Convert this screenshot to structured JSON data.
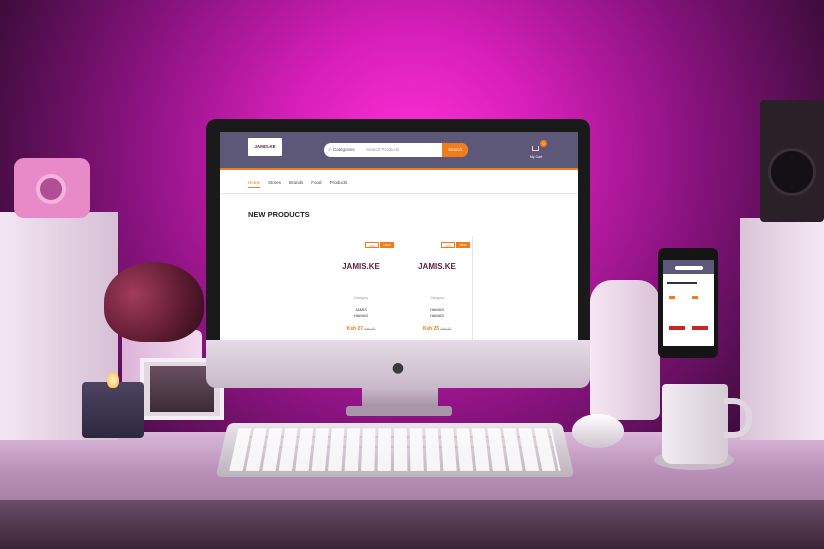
{
  "scene": {
    "description_free": true,
    "accent_color": "#f07d1a",
    "header_color": "#5d5878"
  },
  "site": {
    "logo_text": "JAMIS.KE",
    "search": {
      "category": "✓ Categories",
      "placeholder": "Search Products",
      "button": "Search"
    },
    "cart": {
      "count": "0",
      "label": "My Cart"
    },
    "nav": [
      "Home",
      "Stores",
      "Brands",
      "Food",
      "Products"
    ],
    "section_title": "NEW PRODUCTS",
    "products": [
      {
        "badge_sale": "-10%",
        "badge_new": "NEW",
        "image_text": "JAMIS.KE",
        "category": "Category",
        "name_line1": "JAMIS",
        "name_line2": "HAMAS",
        "price": "Ksh 27",
        "old_price": "Ksh 30"
      },
      {
        "badge_sale": "-10%",
        "badge_new": "NEW",
        "image_text": "JAMIS.KE",
        "category": "Category",
        "name_line1": "HAMAS",
        "name_line2": "HAMAS",
        "price": "Ksh 25",
        "old_price": "Ksh 30"
      }
    ]
  },
  "icons": {
    "apple": "apple-logo-icon",
    "cart": "cart-icon"
  }
}
